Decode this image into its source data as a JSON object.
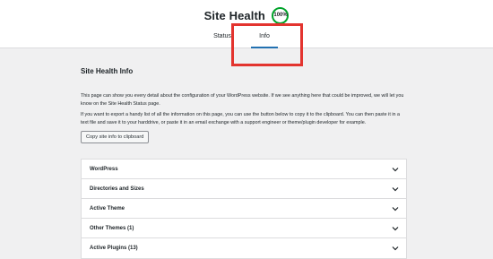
{
  "header": {
    "title": "Site Health",
    "score": "100%",
    "tabs": [
      {
        "label": "Status",
        "active": false
      },
      {
        "label": "Info",
        "active": true
      }
    ],
    "highlight_color": "#e3342f",
    "score_color": "#00a32a"
  },
  "main": {
    "title": "Site Health Info",
    "paragraphs": [
      "This page can show you every detail about the configuration of your WordPress website. If we see anything here that could be improved, we will let you know on the Site Health Status page.",
      "If you want to export a handy list of all the information on this page, you can use the button below to copy it to the clipboard. You can then paste it in a text file and save it to your harddrive, or paste it in an email exchange with a support engineer or theme/plugin developer for example."
    ],
    "copy_button": "Copy site info to clipboard"
  },
  "accordion": {
    "items": [
      {
        "label": "WordPress",
        "icon": "chevron-down-icon"
      },
      {
        "label": "Directories and Sizes",
        "icon": "chevron-down-icon"
      },
      {
        "label": "Active Theme",
        "icon": "chevron-down-icon"
      },
      {
        "label": "Other Themes (1)",
        "icon": "chevron-down-icon"
      },
      {
        "label": "Active Plugins (13)",
        "icon": "chevron-down-icon"
      }
    ]
  }
}
